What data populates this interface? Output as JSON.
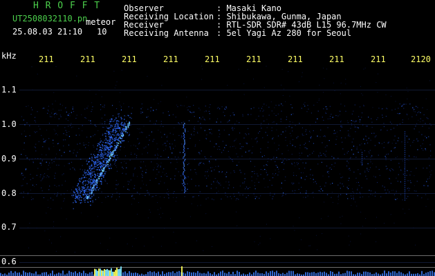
{
  "header": {
    "program": "H R O F F T",
    "filename": "UT2508032110.pn",
    "mode": "meteor",
    "datetime": "25.08.03 21:10",
    "count": "10",
    "fields": [
      {
        "label": "Observer",
        "value": ": Masaki Kano"
      },
      {
        "label": "Receiving Location",
        "value": ": Shibukawa, Gunma, Japan"
      },
      {
        "label": "Receiver",
        "value": ": RTL-SDR SDR# 43dB L15 96.7MHz CW"
      },
      {
        "label": "Receiving Antenna",
        "value": ": 5el Yagi Az 280 for Seoul"
      }
    ]
  },
  "axes": {
    "y_unit": "kHz",
    "y_ticks": [
      "1.1",
      "1.0",
      "0.9",
      "0.8",
      "0.7",
      "0.6"
    ],
    "x_ticks": [
      "211",
      "211",
      "211",
      "211",
      "211",
      "211",
      "211",
      "211",
      "211",
      "2120"
    ]
  },
  "colors": {
    "background": "#000000",
    "header_green": "#4cd04c",
    "tick_yellow": "#ffff66",
    "trace_blue": "#2f6bff",
    "trace_cyan": "#7fe7ff"
  }
}
